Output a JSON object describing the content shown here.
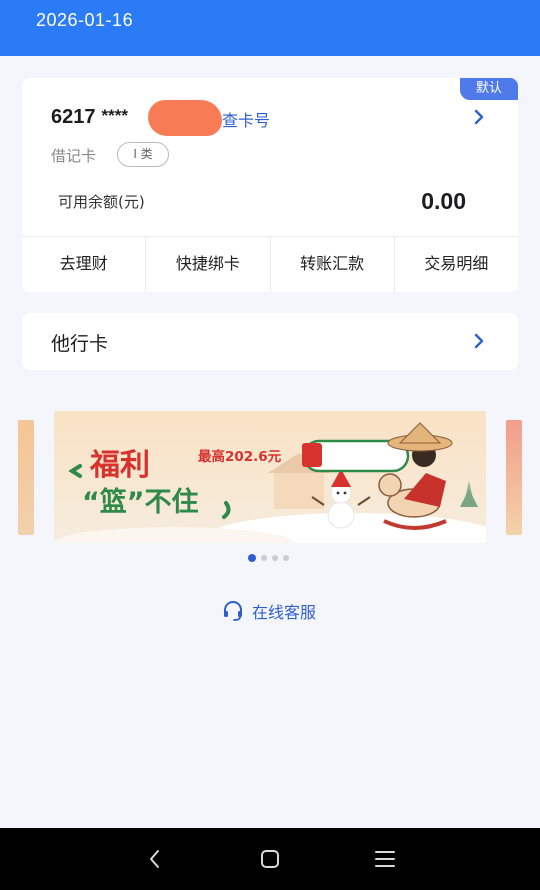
{
  "header": {
    "date": "2026-01-16"
  },
  "card": {
    "default_badge": "默认",
    "number_prefix": "6217",
    "number_mask": "****",
    "view_number_label": "查卡号",
    "type_label": "借记卡",
    "class_tag": "I 类",
    "balance_label": "可用余额(元)",
    "balance_value": "0.00",
    "actions": [
      "去理财",
      "快捷绑卡",
      "转账汇款",
      "交易明细"
    ]
  },
  "other_bank": {
    "label": "他行卡"
  },
  "banner": {
    "headline_1": "福利",
    "headline_2": "“篮”不住",
    "promo": "最高202.6元",
    "slide_count": 4,
    "active_slide": 1
  },
  "service": {
    "label": "在线客服",
    "icon": "headset-icon"
  },
  "system_nav": {
    "icons": [
      "back-icon",
      "home-icon",
      "menu-icon"
    ]
  },
  "colors": {
    "primary": "#2a7bf5",
    "accent": "#2f5fcf",
    "badge": "#4f7bea"
  }
}
